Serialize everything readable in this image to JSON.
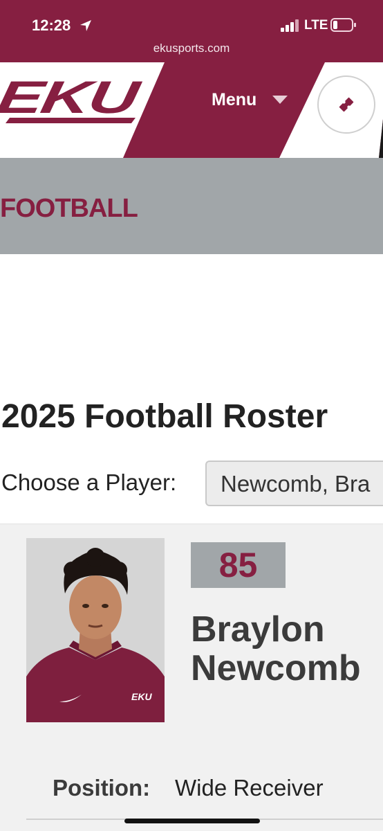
{
  "status_bar": {
    "time": "12:28",
    "network": "LTE"
  },
  "browser": {
    "url": "ekusports.com"
  },
  "header": {
    "logo_text": "EKU",
    "menu_label": "Menu"
  },
  "sport": {
    "title": "FOOTBALL"
  },
  "roster": {
    "title": "2025 Football Roster",
    "choose_label": "Choose a Player:",
    "selected_player": "Newcomb, Bra"
  },
  "player": {
    "number": "85",
    "first_name": "Braylon",
    "last_name": "Newcomb",
    "position_label": "Position:",
    "position_value": "Wide Receiver",
    "shirt_logo": "EKU"
  },
  "colors": {
    "maroon": "#861f41",
    "gray": "#a1a6a9"
  },
  "icons": [
    "location-arrow-icon",
    "signal-icon",
    "battery-icon",
    "chevron-down-icon",
    "ticket-icon"
  ]
}
